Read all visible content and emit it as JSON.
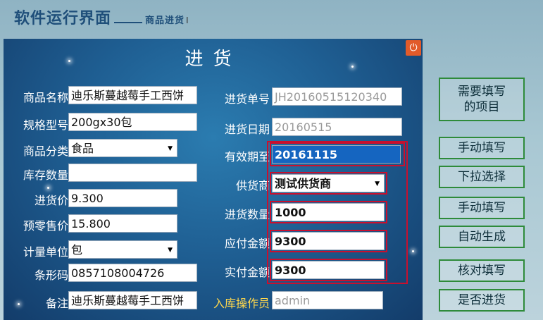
{
  "slide": {
    "title": "软件运行界面",
    "subtitle": "商品进货",
    "cursor_glyph": "I"
  },
  "window": {
    "title": "进货",
    "close_icon": "power-icon"
  },
  "left_fields": {
    "name": {
      "label": "商品名称",
      "value": "迪乐斯蔓越莓手工西饼"
    },
    "spec": {
      "label": "规格型号",
      "value": "200gx30包"
    },
    "category": {
      "label": "商品分类",
      "value": "食品"
    },
    "stock": {
      "label": "库存数量",
      "value": ""
    },
    "purchase_price": {
      "label": "进货价",
      "value": "9.300"
    },
    "retail_price": {
      "label": "预零售价",
      "value": "15.800"
    },
    "unit": {
      "label": "计量单位",
      "value": "包"
    },
    "barcode": {
      "label": "条形码",
      "value": "0857108004726"
    },
    "remark": {
      "label": "备注",
      "value": "迪乐斯蔓越莓手工西饼"
    }
  },
  "right_fields": {
    "order_no": {
      "label": "进货单号",
      "value": "JH20160515120340"
    },
    "date": {
      "label": "进货日期",
      "value": "20160515"
    },
    "expiry": {
      "label": "有效期至",
      "value": "20161115"
    },
    "supplier": {
      "label": "供货商",
      "value": "测试供货商"
    },
    "quantity": {
      "label": "进货数量",
      "value": "1000"
    },
    "payable": {
      "label": "应付金额",
      "value": "9300"
    },
    "paid": {
      "label": "实付金额",
      "value": "9300"
    },
    "operator": {
      "label": "入库操作员",
      "value": "admin"
    }
  },
  "annotations": [
    "需要填写\n的项目",
    "手动填写",
    "下拉选择",
    "手动填写",
    "自动生成",
    "核对填写",
    "是否进货"
  ],
  "colors": {
    "panel": "#1f5f93",
    "highlight_box": "#c8102e",
    "annotation_border": "#2e8b3a",
    "selected_field": "#1565c0"
  }
}
